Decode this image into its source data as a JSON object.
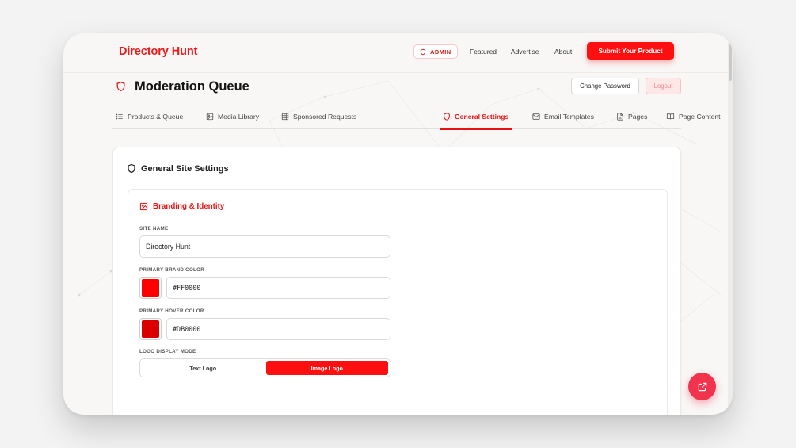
{
  "header": {
    "brand": "Directory Hunt",
    "admin_badge": "ADMIN",
    "nav": [
      "Featured",
      "Advertise",
      "About"
    ],
    "submit_button": "Submit Your Product"
  },
  "title_row": {
    "title": "Moderation Queue",
    "change_password": "Change Password",
    "logout": "Logout"
  },
  "tabs": [
    {
      "label": "Products & Queue",
      "icon": "list-icon",
      "active": false
    },
    {
      "label": "Media Library",
      "icon": "image-icon",
      "active": false
    },
    {
      "label": "Sponsored Requests",
      "icon": "grid-icon",
      "active": false
    },
    {
      "label": "General Settings",
      "icon": "shield-icon",
      "active": true
    },
    {
      "label": "Email Templates",
      "icon": "mail-icon",
      "active": false
    },
    {
      "label": "Pages",
      "icon": "document-icon",
      "active": false
    },
    {
      "label": "Page Content",
      "icon": "book-icon",
      "active": false
    }
  ],
  "settings": {
    "card_title": "General Site Settings",
    "section_title": "Branding & Identity",
    "site_name_label": "SITE NAME",
    "site_name_value": "Directory Hunt",
    "primary_color_label": "PRIMARY BRAND COLOR",
    "primary_color_value": "#FF0000",
    "hover_color_label": "PRIMARY HOVER COLOR",
    "hover_color_value": "#DB0000",
    "logo_mode_label": "LOGO DISPLAY MODE",
    "logo_mode_options": [
      "Text Logo",
      "Image Logo"
    ],
    "logo_mode_selected": "Image Logo"
  },
  "colors": {
    "accent": "#FF0000",
    "accent_hover": "#DB0000",
    "fab": "#F2334E"
  },
  "fab_icon": "external-link-icon"
}
